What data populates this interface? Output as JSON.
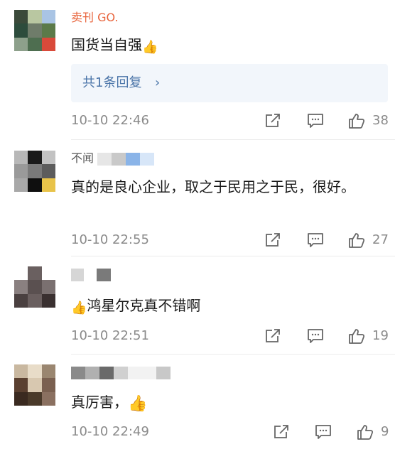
{
  "comments": [
    {
      "username": "卖刊 GO.",
      "text": "国货当自强",
      "text_emoji": "👍",
      "reply_label": "共1条回复",
      "reply_chevron": "›",
      "time": "10-10 22:46",
      "likes": "38"
    },
    {
      "username": "不闻",
      "text": "真的是良心企业，取之于民用之于民，很好。",
      "time": "10-10 22:55",
      "likes": "27"
    },
    {
      "username": "",
      "text_emoji": "👍",
      "text": "鸿星尔克真不错啊",
      "time": "10-10 22:51",
      "likes": "19"
    },
    {
      "username": "",
      "text": "真厉害，",
      "text_emoji": "👍",
      "time": "10-10 22:49",
      "likes": "9"
    }
  ],
  "icons": {
    "repost": "share-box-icon",
    "comment": "comment-icon",
    "like": "thumbs-up-icon"
  },
  "colors": {
    "username": "#e8643c",
    "reply_link": "#4a74a8",
    "meta_text": "#8a8a8a"
  }
}
